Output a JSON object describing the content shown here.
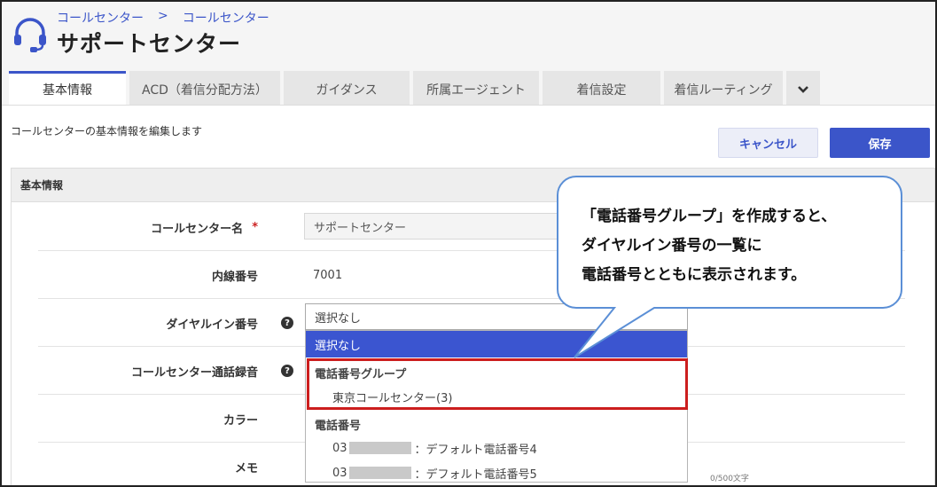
{
  "breadcrumb": {
    "parent": "コールセンター",
    "separator": ">",
    "current": "コールセンター"
  },
  "page_title": "サポートセンター",
  "tabs": [
    {
      "label": "基本情報",
      "active": true
    },
    {
      "label": "ACD（着信分配方法）"
    },
    {
      "label": "ガイダンス"
    },
    {
      "label": "所属エージェント"
    },
    {
      "label": "着信設定"
    },
    {
      "label": "着信ルーティング"
    }
  ],
  "toolbar": {
    "description": "コールセンターの基本情報を編集します",
    "cancel_label": "キャンセル",
    "save_label": "保存"
  },
  "section": {
    "title": "基本情報",
    "fields": {
      "name": {
        "label": "コールセンター名",
        "required_mark": "*",
        "value": "サポートセンター"
      },
      "extension": {
        "label": "内線番号",
        "value": "7001"
      },
      "dial_in": {
        "label": "ダイヤルイン番号",
        "value": "選択なし"
      },
      "recording": {
        "label": "コールセンター通話録音"
      },
      "color": {
        "label": "カラー"
      },
      "memo": {
        "label": "メモ",
        "counter": "0/500文字"
      }
    }
  },
  "dropdown": {
    "selected": "選択なし",
    "group1": {
      "title": "電話番号グループ",
      "items": [
        "東京コールセンター(3)"
      ]
    },
    "group2": {
      "title": "電話番号",
      "items": [
        {
          "prefix": "03",
          "suffix": "：デフォルト電話番号4"
        },
        {
          "prefix": "03",
          "suffix": "：デフォルト電話番号5"
        }
      ]
    }
  },
  "callout": {
    "line1": "「電話番号グループ」を作成すると、",
    "line2": "ダイヤルイン番号の一覧に",
    "line3": "電話番号とともに表示されます。"
  },
  "colors": {
    "accent": "#3b55c9",
    "highlight": "#cc1e1e",
    "callout_border": "#5b8fd6"
  }
}
